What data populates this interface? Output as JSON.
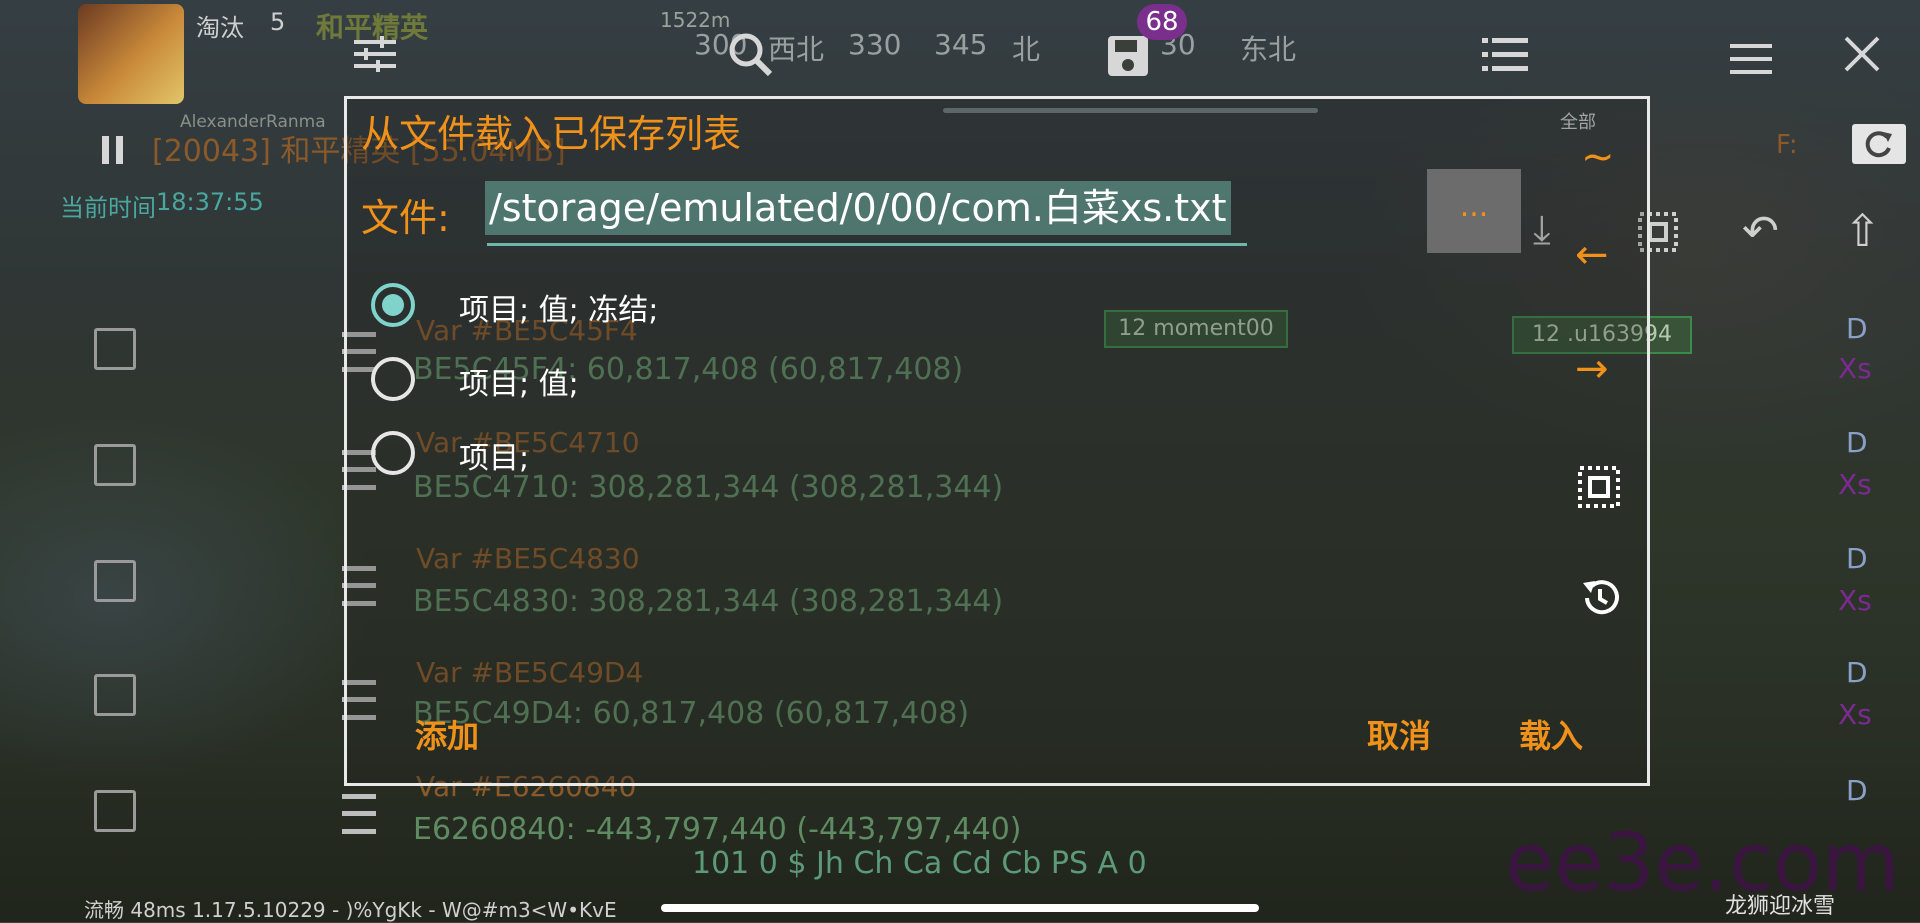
{
  "overlay": {
    "player_label": "淘汰",
    "kills": "5",
    "mode_tag": "和平精英",
    "distance": "1522m",
    "compass": [
      "300",
      "西北",
      "330",
      "345",
      "北",
      "30",
      "东北"
    ],
    "process_line": "[20043] 和平精英 [55.04MB]",
    "time_label": "当前时间",
    "time_value": "18:37:55",
    "name_tag": "AlexanderRanma",
    "all_label": "全部",
    "f_label": "F:",
    "badge": "68"
  },
  "background_list": [
    {
      "var": "Var #BE5C45F4",
      "line": "BE5C45F4:     60,817,408 (60,817,408)",
      "flag_d": "D",
      "flag_xs": "Xs"
    },
    {
      "var": "Var #BE5C4710",
      "line": "BE5C4710:     308,281,344 (308,281,344)",
      "flag_d": "D",
      "flag_xs": "Xs"
    },
    {
      "var": "Var #BE5C4830",
      "line": "BE5C4830:     308,281,344 (308,281,344)",
      "flag_d": "D",
      "flag_xs": "Xs"
    },
    {
      "var": "Var #BE5C49D4",
      "line": "BE5C49D4:     60,817,408 (60,817,408)",
      "flag_d": "D",
      "flag_xs": "Xs"
    },
    {
      "var": "Var #E6260840",
      "line": "E6260840:     -443,797,440 (-443,797,440)",
      "flag_d": "D",
      "flag_xs": "Xs"
    }
  ],
  "hud_labels": {
    "moment": "12 moment00",
    "u_tag": "12 .u163994"
  },
  "dialog": {
    "title": "从文件载入已保存列表",
    "file_label": "文件:",
    "file_path": "/storage/emulated/0/00/com.白菜xs.txt",
    "browse_label": "...",
    "options": [
      {
        "label": "项目; 值; 冻结;",
        "selected": true
      },
      {
        "label": "项目; 值;",
        "selected": false
      },
      {
        "label": "项目;",
        "selected": false
      }
    ],
    "add_label": "添加",
    "cancel_label": "取消",
    "load_label": "载入"
  },
  "side_glyphs": {
    "tilde": "~",
    "left_arrow": "←",
    "right_arrow": "→"
  },
  "bottom": {
    "code_line": "101 0 $ Jh Ch Ca Cd Cb PS A 0",
    "status_line": "流畅   48ms  1.17.5.10229 - )%YgKk - W@#m3<W•KvE",
    "watermark": "ee3e.com",
    "corner_text": "龙狮迎冰雪"
  },
  "colors": {
    "accent_orange": "#f0921a",
    "radio_teal": "#7fd3cb",
    "var_title": "#8a5a2a",
    "var_line": "#5f8b63",
    "xs_purple": "#7c2a92"
  },
  "icons": [
    "sliders-icon",
    "search-icon",
    "save-icon",
    "list-icon",
    "menu-icon",
    "close-icon",
    "pause-icon",
    "refresh-icon",
    "download-icon",
    "select-icon",
    "undo-icon",
    "upload-icon",
    "history-icon",
    "trash-icon"
  ]
}
